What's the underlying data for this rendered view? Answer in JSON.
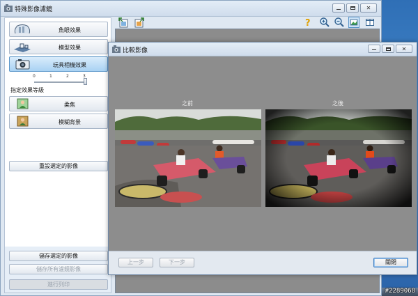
{
  "main_window": {
    "title": "特殊影像濾鏡",
    "buttons": {
      "minimize": "minimize",
      "maximize": "maximize",
      "close": "close"
    }
  },
  "effects": [
    {
      "label": "魚眼效果",
      "icon": "fisheye-icon"
    },
    {
      "label": "模型效果",
      "icon": "miniature-icon"
    },
    {
      "label": "玩具相機效果",
      "icon": "toy-camera-icon",
      "active": true
    }
  ],
  "slider": {
    "ticks": [
      "0",
      "1",
      "2",
      "3"
    ],
    "value": 3,
    "label": "指定效果等級"
  },
  "extra_effects": [
    {
      "label": "柔焦",
      "icon": "soft-focus-icon"
    },
    {
      "label": "模糊背景",
      "icon": "blur-background-icon"
    }
  ],
  "reset_button": "重設選定的影像",
  "save_selected": "儲存選定的影像",
  "save_all": "儲存所有濾鏡影像",
  "print": "進行列印",
  "toolbar_icons": [
    "rotate-left-icon",
    "rotate-right-icon",
    "help-icon",
    "zoom-in-icon",
    "zoom-out-icon",
    "fit-window-icon",
    "compare-view-icon"
  ],
  "dialog": {
    "title": "比較影像",
    "before_label": "之前",
    "after_label": "之後",
    "prev_button": "上一步",
    "next_button": "下一步",
    "close_button": "關閉"
  },
  "watermark": "#2289068",
  "colors": {
    "active_button": "#a9d2f3",
    "dialog_bg": "#8d8d8d",
    "window_frame": "#8aa3bf"
  }
}
